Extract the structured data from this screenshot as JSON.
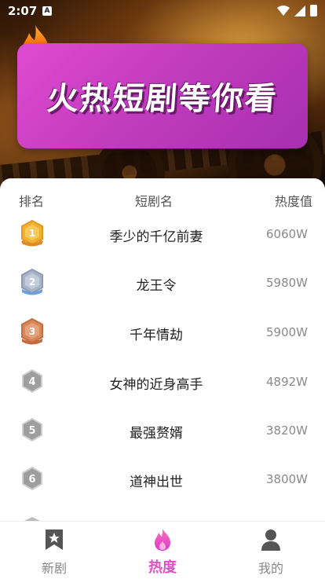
{
  "status_bar": {
    "time": "2:07",
    "notice_icon_letter": "A"
  },
  "banner": {
    "title": "火热短剧等你看"
  },
  "table": {
    "headers": {
      "rank": "排名",
      "name": "短剧名",
      "heat": "热度值"
    },
    "rows": [
      {
        "rank": 1,
        "name": "季少的千亿前妻",
        "heat": "6060W",
        "badge": "gold-medal-icon"
      },
      {
        "rank": 2,
        "name": "龙王令",
        "heat": "5980W",
        "badge": "silver-medal-icon"
      },
      {
        "rank": 3,
        "name": "千年情劫",
        "heat": "5900W",
        "badge": "bronze-medal-icon"
      },
      {
        "rank": 4,
        "name": "女神的近身高手",
        "heat": "4892W",
        "badge": "rank-4-icon"
      },
      {
        "rank": 5,
        "name": "最强赘婿",
        "heat": "3820W",
        "badge": "rank-5-icon"
      },
      {
        "rank": 6,
        "name": "道神出世",
        "heat": "3800W",
        "badge": "rank-6-icon"
      }
    ]
  },
  "tabs": [
    {
      "label": "新剧",
      "icon": "bookmark-star-icon",
      "active": false
    },
    {
      "label": "热度",
      "icon": "flame-icon",
      "active": true
    },
    {
      "label": "我的",
      "icon": "person-icon",
      "active": false
    }
  ],
  "colors": {
    "accent": "#e34fc0",
    "banner": "#c33cbf",
    "gold": "#f2b035",
    "silver": "#a9b4c6",
    "bronze": "#d9875a",
    "gray_badge": "#9e9e9e"
  }
}
